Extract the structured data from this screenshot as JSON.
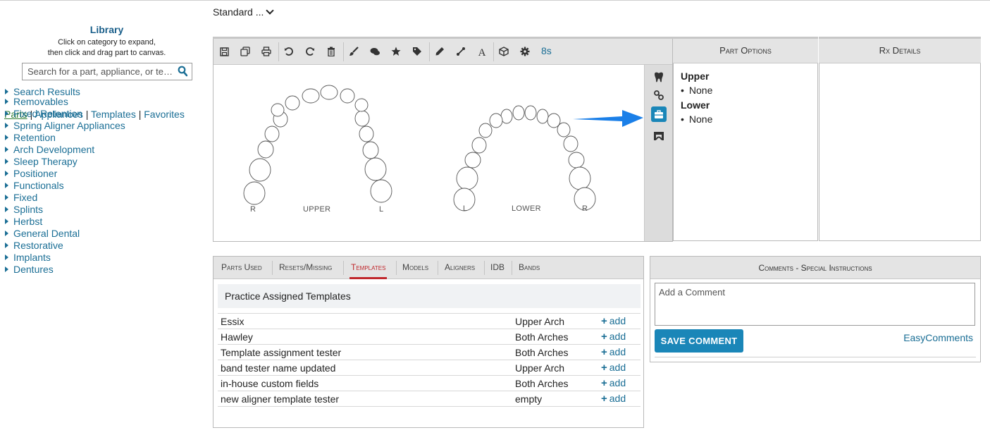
{
  "header": {
    "standard_label": "Standard ..."
  },
  "library": {
    "title": "Library",
    "help_line1": "Click on category to expand,",
    "help_line2": "then click and drag part to canvas.",
    "search_placeholder": "Search for a part, appliance, or te…",
    "search_results": "Search Results",
    "tabs": [
      "Parts",
      "Appliances",
      "Templates",
      "Favorites"
    ],
    "tab_separator": "|",
    "categories": [
      "Removables",
      "Fixed Retention",
      "Spring Aligner Appliances",
      "Retention",
      "Arch Development",
      "Sleep Therapy",
      "Positioner",
      "Functionals",
      "Fixed",
      "Splints",
      "Herbst",
      "General Dental",
      "Restorative",
      "Implants",
      "Dentures"
    ]
  },
  "toolbar": {
    "timer": "8s",
    "icons": [
      "save-icon",
      "copy-icon",
      "print-icon",
      "undo-icon",
      "redo-icon",
      "trash-icon",
      "brush-icon",
      "comments-icon",
      "star-icon",
      "tag-icon",
      "pencil-icon",
      "line-tool-icon",
      "text-icon",
      "cube-icon",
      "gear-icon"
    ]
  },
  "canvas": {
    "upper": {
      "left": "R",
      "center": "UPPER",
      "right": "L"
    },
    "lower": {
      "left": "L",
      "center": "LOWER",
      "right": "R"
    },
    "side_icons": [
      "tooth-icon",
      "link-icon",
      "briefcase-icon",
      "bridge-icon"
    ]
  },
  "part_options": {
    "title": "Part Options",
    "groups": [
      {
        "name": "Upper",
        "items": [
          "None"
        ]
      },
      {
        "name": "Lower",
        "items": [
          "None"
        ]
      }
    ]
  },
  "rx_details": {
    "title": "Rx Details"
  },
  "bottom_tabs": {
    "tabs": [
      "Parts Used",
      "Resets/Missing",
      "Templates",
      "Models",
      "Aligners",
      "IDB",
      "Bands"
    ],
    "active": "Templates",
    "section_title": "Practice Assigned Templates",
    "add_label": "add",
    "rows": [
      {
        "name": "Essix",
        "arch": "Upper Arch"
      },
      {
        "name": "Hawley",
        "arch": "Both Arches"
      },
      {
        "name": "Template assignment tester",
        "arch": "Both Arches"
      },
      {
        "name": "band tester name updated",
        "arch": "Upper Arch"
      },
      {
        "name": "in-house custom fields",
        "arch": "Both Arches"
      },
      {
        "name": "new aligner template tester",
        "arch": "empty"
      }
    ]
  },
  "comments": {
    "title": "Comments - Special Instructions",
    "placeholder": "Add a Comment",
    "save_label": "SAVE COMMENT",
    "easy_label": "EasyComments"
  },
  "colors": {
    "accent": "#1a86b8",
    "link": "#1a6e95",
    "active_tab": "#c0282d",
    "active_lib_tab": "#2e7d32"
  }
}
